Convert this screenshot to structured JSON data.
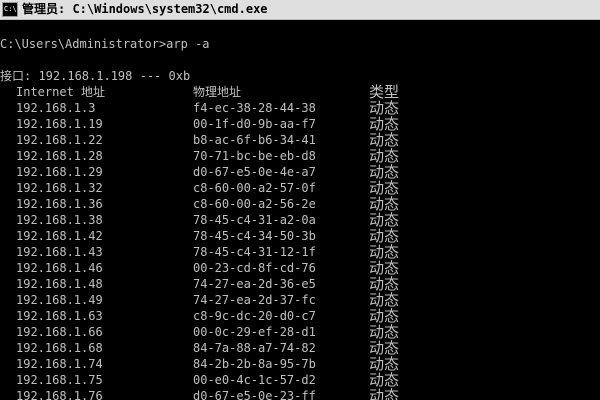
{
  "window": {
    "title": "管理员: C:\\Windows\\system32\\cmd.exe",
    "icon_label": "C:\\",
    "icon": "cmd-icon"
  },
  "console": {
    "prompt": "C:\\Users\\Administrator>arp -a",
    "interface_line": "接口: 192.168.1.198 --- 0xb",
    "headers": {
      "ip": "Internet 地址",
      "mac": "物理地址",
      "type": "类型"
    },
    "rows": [
      {
        "ip": "192.168.1.3",
        "mac": "f4-ec-38-28-44-38",
        "type": "动态"
      },
      {
        "ip": "192.168.1.19",
        "mac": "00-1f-d0-9b-aa-f7",
        "type": "动态"
      },
      {
        "ip": "192.168.1.22",
        "mac": "b8-ac-6f-b6-34-41",
        "type": "动态"
      },
      {
        "ip": "192.168.1.28",
        "mac": "70-71-bc-be-eb-d8",
        "type": "动态"
      },
      {
        "ip": "192.168.1.29",
        "mac": "d0-67-e5-0e-4e-a7",
        "type": "动态"
      },
      {
        "ip": "192.168.1.32",
        "mac": "c8-60-00-a2-57-0f",
        "type": "动态"
      },
      {
        "ip": "192.168.1.36",
        "mac": "c8-60-00-a2-56-2e",
        "type": "动态"
      },
      {
        "ip": "192.168.1.38",
        "mac": "78-45-c4-31-a2-0a",
        "type": "动态"
      },
      {
        "ip": "192.168.1.42",
        "mac": "78-45-c4-34-50-3b",
        "type": "动态"
      },
      {
        "ip": "192.168.1.43",
        "mac": "78-45-c4-31-12-1f",
        "type": "动态"
      },
      {
        "ip": "192.168.1.46",
        "mac": "00-23-cd-8f-cd-76",
        "type": "动态"
      },
      {
        "ip": "192.168.1.48",
        "mac": "74-27-ea-2d-36-e5",
        "type": "动态"
      },
      {
        "ip": "192.168.1.49",
        "mac": "74-27-ea-2d-37-fc",
        "type": "动态"
      },
      {
        "ip": "192.168.1.63",
        "mac": "c8-9c-dc-20-d0-c7",
        "type": "动态"
      },
      {
        "ip": "192.168.1.66",
        "mac": "00-0c-29-ef-28-d1",
        "type": "动态"
      },
      {
        "ip": "192.168.1.68",
        "mac": "84-7a-88-a7-74-82",
        "type": "动态"
      },
      {
        "ip": "192.168.1.74",
        "mac": "84-2b-2b-8a-95-7b",
        "type": "动态"
      },
      {
        "ip": "192.168.1.75",
        "mac": "00-e0-4c-1c-57-d2",
        "type": "动态"
      },
      {
        "ip": "192.168.1.76",
        "mac": "d0-67-e5-0e-23-ff",
        "type": "动态"
      }
    ]
  },
  "colors": {
    "console_bg": "#000000",
    "console_text": "#c0c0c0",
    "titlebar_bg": "#dfdfdf"
  }
}
